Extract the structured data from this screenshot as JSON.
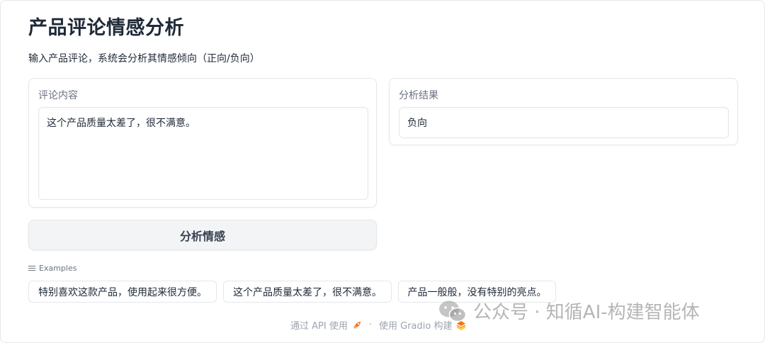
{
  "header": {
    "title": "产品评论情感分析",
    "description": "输入产品评论，系统会分析其情感倾向（正向/负向）"
  },
  "input_panel": {
    "label": "评论内容",
    "value": "这个产品质量太差了，很不满意。"
  },
  "output_panel": {
    "label": "分析结果",
    "value": "负向"
  },
  "action": {
    "submit_label": "分析情感"
  },
  "examples": {
    "label": "Examples",
    "icon": "list-icon",
    "items": [
      "特别喜欢这款产品，使用起来很方便。",
      "这个产品质量太差了，很不满意。",
      "产品一般般，没有特别的亮点。"
    ]
  },
  "footer": {
    "api_link": "通过 API 使用",
    "separator": "·",
    "built_with": "使用 Gradio 构建",
    "api_icon": "rocket-icon",
    "gradio_icon": "gradio-logo-icon"
  },
  "watermark": {
    "text": "公众号 · 知循AI-构建智能体",
    "icon": "wechat-icon"
  }
}
